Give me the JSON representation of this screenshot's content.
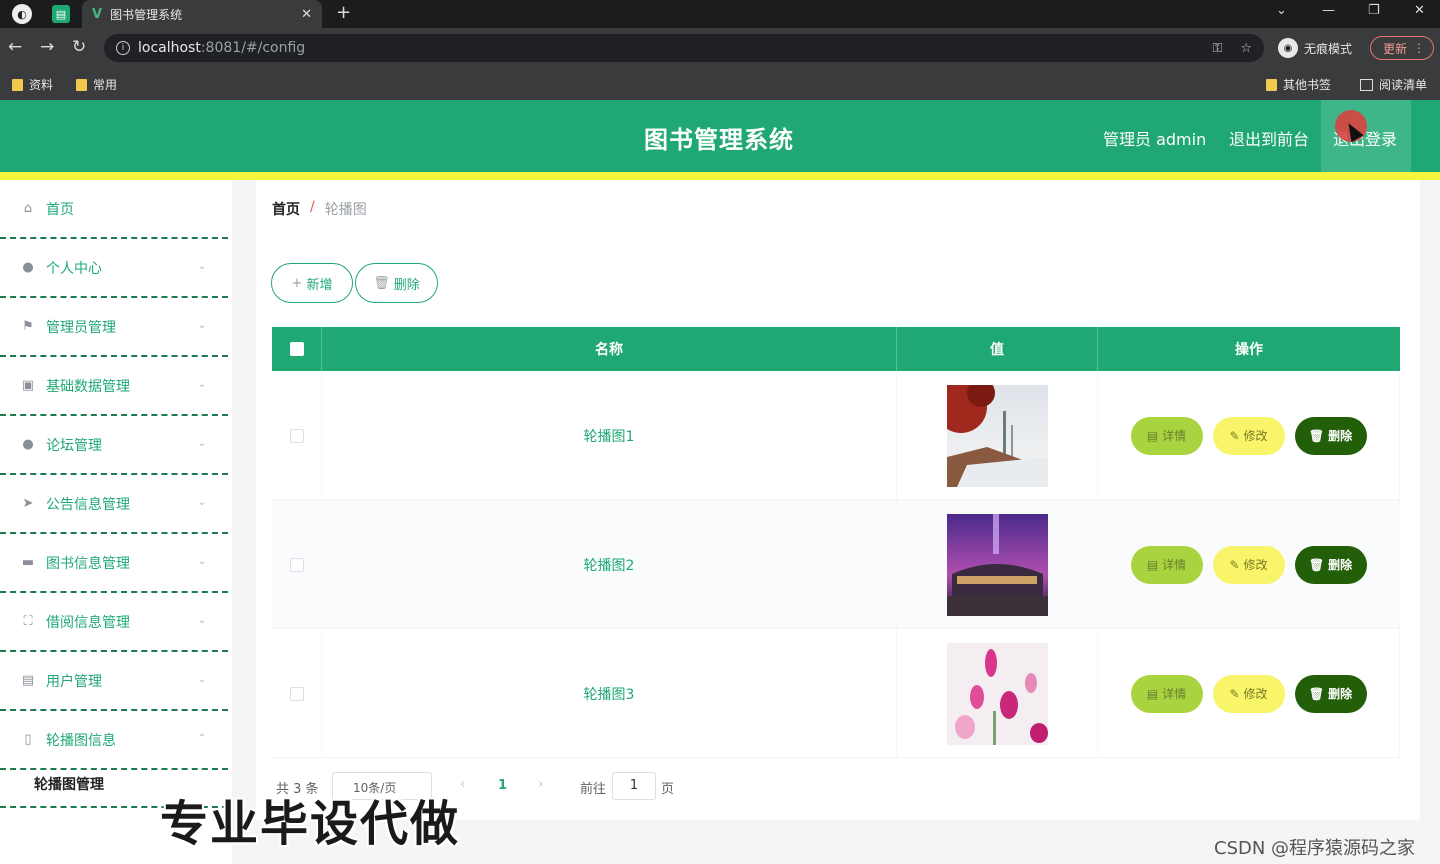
{
  "browser": {
    "tab_title": "图书管理系统",
    "url_host": "localhost",
    "url_path": ":8081/#/config",
    "incognito_label": "无痕模式",
    "update_label": "更新",
    "bookmarks": [
      "资料",
      "常用"
    ],
    "bookmarks_right": [
      "其他书签",
      "阅读清单"
    ]
  },
  "header": {
    "title": "图书管理系统",
    "admin_label": "管理员 admin",
    "front_label": "退出到前台",
    "logout_label": "退出登录"
  },
  "sidebar": {
    "items": [
      {
        "label": "首页",
        "icon": "home-icon",
        "glyph": "⌂",
        "chevron": ""
      },
      {
        "label": "个人中心",
        "icon": "user-icon",
        "glyph": "●",
        "chevron": "⌄"
      },
      {
        "label": "管理员管理",
        "icon": "flag-icon",
        "glyph": "⚑",
        "chevron": "⌄"
      },
      {
        "label": "基础数据管理",
        "icon": "chart-icon",
        "glyph": "▣",
        "chevron": "⌄"
      },
      {
        "label": "论坛管理",
        "icon": "user-icon",
        "glyph": "●",
        "chevron": "⌄"
      },
      {
        "label": "公告信息管理",
        "icon": "send-icon",
        "glyph": "➤",
        "chevron": "⌄"
      },
      {
        "label": "图书信息管理",
        "icon": "briefcase-icon",
        "glyph": "▬",
        "chevron": "⌄"
      },
      {
        "label": "借阅信息管理",
        "icon": "fullscreen-icon",
        "glyph": "⛶",
        "chevron": "⌄"
      },
      {
        "label": "用户管理",
        "icon": "document-icon",
        "glyph": "▤",
        "chevron": "⌄"
      },
      {
        "label": "轮播图信息",
        "icon": "mobile-icon",
        "glyph": "▯",
        "chevron": "⌃"
      }
    ],
    "submenu": "轮播图管理"
  },
  "breadcrumb": {
    "home": "首页",
    "sep": "/",
    "current": "轮播图"
  },
  "toolbar": {
    "add_label": "新增",
    "add_icon": "+",
    "delete_label": "删除",
    "delete_icon": "🗑"
  },
  "table": {
    "columns": [
      "名称",
      "值",
      "操作"
    ],
    "rows": [
      {
        "name": "轮播图1",
        "image": "image-1"
      },
      {
        "name": "轮播图2",
        "image": "image-2"
      },
      {
        "name": "轮播图3",
        "image": "image-3"
      }
    ],
    "actions": {
      "detail": "详情",
      "edit": "修改",
      "delete": "删除"
    }
  },
  "pagination": {
    "total": "共 3 条",
    "page_size": "10条/页",
    "current": "1",
    "goto": "前往",
    "goto_value": "1",
    "page_suffix": "页"
  },
  "watermark": "专业毕设代做",
  "credit": "CSDN @程序猿源码之家",
  "colors": {
    "brand": "#1fa874",
    "accent_bar": "#f5f53b",
    "detail": "#aad43f",
    "edit": "#f8f56a",
    "delete": "#225f08"
  }
}
